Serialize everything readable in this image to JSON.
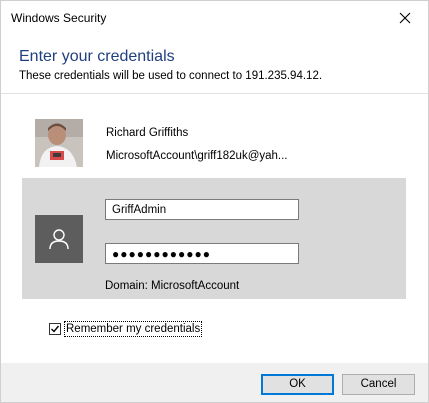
{
  "window": {
    "title": "Windows Security"
  },
  "dialog": {
    "heading": "Enter your credentials",
    "subheading": "These credentials will be used to connect to 191.235.94.12."
  },
  "saved_user": {
    "name": "Richard Griffiths",
    "account": "MicrosoftAccount\\griff182uk@yah..."
  },
  "credentials": {
    "username_value": "GriffAdmin",
    "password_value": "●●●●●●●●●●●●",
    "domain_text": "Domain: MicrosoftAccount"
  },
  "remember": {
    "label": "Remember my credentials",
    "checked": true
  },
  "buttons": {
    "ok": "OK",
    "cancel": "Cancel"
  },
  "icons": {
    "close": "close-icon",
    "person": "person-icon",
    "checkmark": "checkmark-icon"
  }
}
